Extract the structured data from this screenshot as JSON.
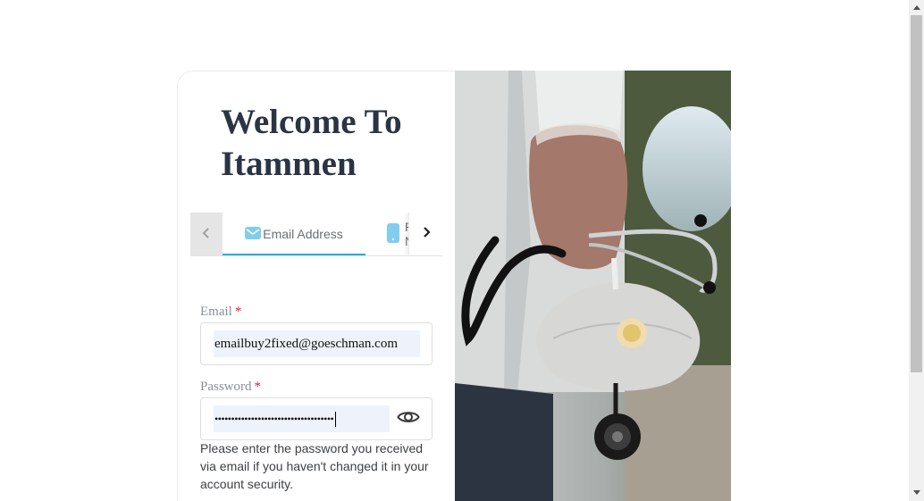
{
  "welcome": {
    "title": "Welcome To Itammen"
  },
  "tabs": {
    "items": [
      {
        "label": "Email Address",
        "icon": "email-icon",
        "active": true
      },
      {
        "label": "Phone Number",
        "icon": "phone-icon",
        "active": false
      }
    ],
    "prev_icon": "chevron-left-icon",
    "next_icon": "chevron-right-icon"
  },
  "form": {
    "email": {
      "label": "Email",
      "required_mark": "*",
      "value": "emailbuy2fixed@goeschman.com"
    },
    "password": {
      "label": "Password",
      "required_mark": "*",
      "value": "••••••••••••••••••••••••••••••••••••",
      "toggle_icon": "eye-icon"
    },
    "help_text": "Please enter the password you received via email if you haven't changed it in your account security."
  },
  "colors": {
    "accent": "#29a9e1",
    "heading": "#2b3445",
    "required": "#e0211b",
    "input_fill": "#eef2fb"
  }
}
